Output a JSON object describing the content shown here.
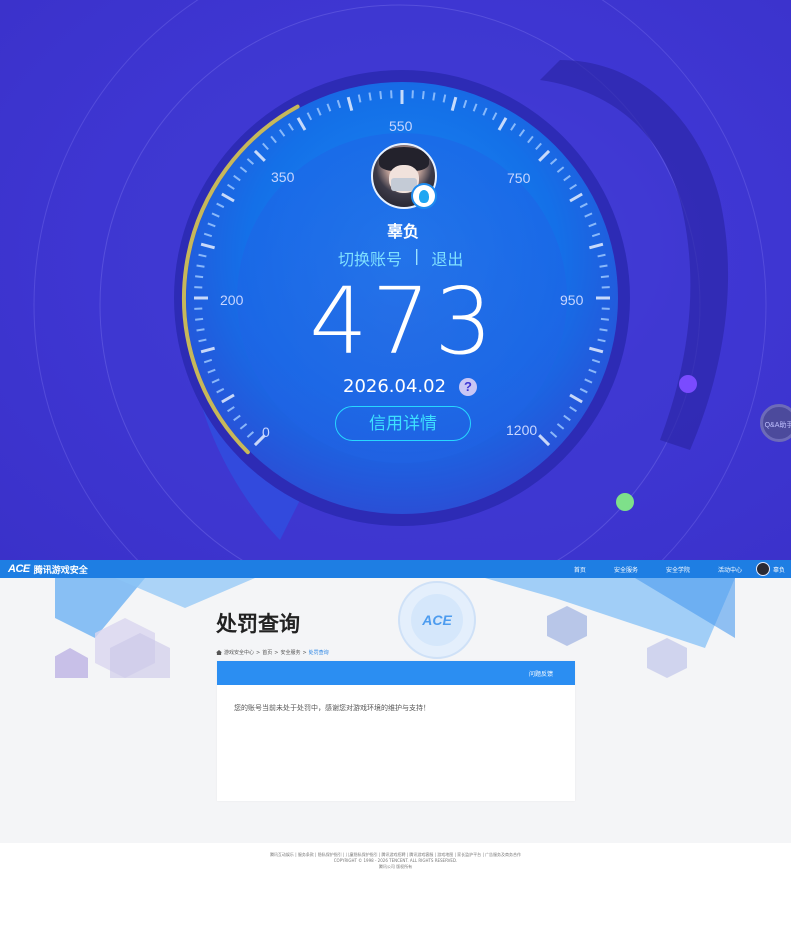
{
  "credit": {
    "nickname": "辜负",
    "switch_account": "切换账号",
    "separator": "|",
    "logout": "退出",
    "score": "473",
    "date": "2026.04.02",
    "help_symbol": "?",
    "detail_button": "信用详情",
    "gauge_min": 0,
    "gauge_max": 1200,
    "score_fraction": 0.394,
    "tick_labels": [
      "0",
      "200",
      "350",
      "550",
      "750",
      "950",
      "1200"
    ],
    "side_badge": "Q&A助手"
  },
  "topbar": {
    "logo_mark": "ACE",
    "logo_text": "腾讯游戏安全",
    "nav_items": [
      "首页",
      "安全服务",
      "安全学院",
      "活动中心"
    ],
    "user_name": "辜负"
  },
  "page": {
    "title": "处罚查询",
    "breadcrumb": [
      "游戏安全中心",
      "首页",
      "安全服务",
      "处罚查询"
    ],
    "breadcrumb_seps": [
      ">",
      ">",
      ">"
    ],
    "feedback_label": "问题反馈",
    "message": "您的账号当前未处于处罚中，感谢您对游戏环境的维护与支持！"
  },
  "footer": {
    "line1": "腾讯互动娱乐 | 服务条款 | 隐私保护指引 | 儿童隐私保护指引 | 腾讯游戏招聘 | 腾讯游戏客服 | 游戏地图 | 家长监护平台 | 广告服务及商务合作",
    "line2": "COPYRIGHT © 1998 - 2026 TENCENT. ALL RIGHTS RESERVED.",
    "line3": "腾讯公司 版权所有"
  },
  "colors": {
    "hero_bg": "#3f37d4",
    "accent_cyan": "#3de0ff",
    "nav_blue": "#1e7ee3",
    "card_head": "#2b8ef2",
    "gauge_arc": "#c7b85a"
  }
}
